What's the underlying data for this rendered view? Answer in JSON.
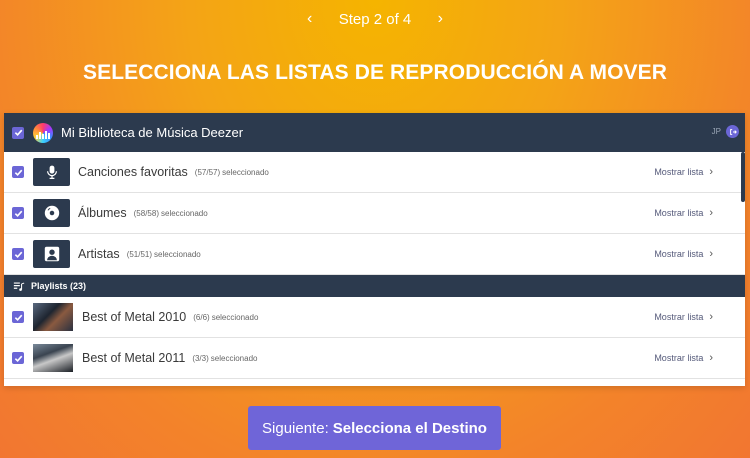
{
  "stepper": {
    "prev": "‹",
    "label": "Step 2 of 4",
    "next": "›"
  },
  "title": "SELECCIONA LAS LISTAS DE REPRODUCCIÓN A MOVER",
  "library": {
    "title": "Mi Biblioteca de Música Deezer",
    "initials": "JP"
  },
  "show_label": "Mostrar lista",
  "selected_word": "seleccionado",
  "items": [
    {
      "title": "Canciones favoritas",
      "count": "(57/57)",
      "icon": "microphone-icon"
    },
    {
      "title": "Álbumes",
      "count": "(58/58)",
      "icon": "vinyl-disc-icon"
    },
    {
      "title": "Artistas",
      "count": "(51/51)",
      "icon": "person-icon"
    }
  ],
  "playlists_section": {
    "label": "Playlists (23)",
    "icon": "playlist-icon"
  },
  "playlists": [
    {
      "title": "Best of Metal 2010",
      "count": "(6/6)"
    },
    {
      "title": "Best of Metal 2011",
      "count": "(3/3)"
    }
  ],
  "button": {
    "prefix": "Siguiente:",
    "bold": "Selecciona el Destino"
  },
  "colors": {
    "accent": "#6b66d6",
    "header": "#2c3a4e"
  }
}
